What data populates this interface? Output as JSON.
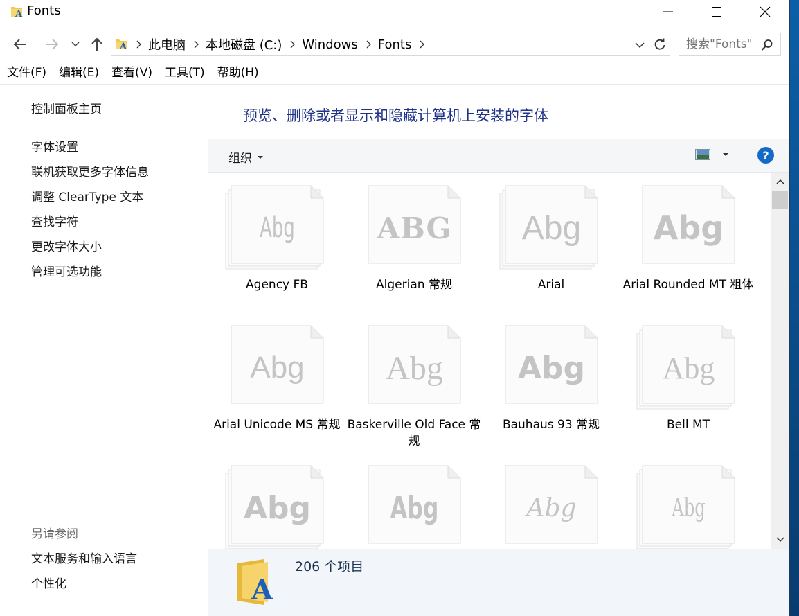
{
  "window": {
    "title": "Fonts"
  },
  "nav": {
    "breadcrumbs": [
      "此电脑",
      "本地磁盘 (C:)",
      "Windows",
      "Fonts"
    ],
    "search_placeholder": "搜索\"Fonts\""
  },
  "menu": [
    "文件(F)",
    "编辑(E)",
    "查看(V)",
    "工具(T)",
    "帮助(H)"
  ],
  "left_pane": {
    "home": "控制面板主页",
    "links": [
      "字体设置",
      "联机获取更多字体信息",
      "调整 ClearType 文本",
      "查找字符",
      "更改字体大小",
      "管理可选功能"
    ],
    "see_also_heading": "另请参阅",
    "see_also": [
      "文本服务和输入语言",
      "个性化"
    ]
  },
  "main": {
    "heading": "预览、删除或者显示和隐藏计算机上安装的字体",
    "organize_label": "组织",
    "help_label": "?"
  },
  "fonts": [
    {
      "label": "Agency FB",
      "preview": "Abg",
      "stacked": true
    },
    {
      "label": "Algerian 常规",
      "preview": "ABG",
      "stacked": false
    },
    {
      "label": "Arial",
      "preview": "Abg",
      "stacked": true
    },
    {
      "label": "Arial Rounded MT 粗体",
      "preview": "Abg",
      "stacked": false
    },
    {
      "label": "Arial Unicode MS 常规",
      "preview": "Abg",
      "stacked": false
    },
    {
      "label": "Baskerville Old Face 常规",
      "preview": "Abg",
      "stacked": false
    },
    {
      "label": "Bauhaus 93 常规",
      "preview": "Abg",
      "stacked": false
    },
    {
      "label": "Bell MT",
      "preview": "Abg",
      "stacked": true
    },
    {
      "label": "",
      "preview": "Abg",
      "stacked": true
    },
    {
      "label": "",
      "preview": "Abg",
      "stacked": false
    },
    {
      "label": "",
      "preview": "Abg",
      "stacked": false
    },
    {
      "label": "",
      "preview": "Abg",
      "stacked": true
    }
  ],
  "details": {
    "count_text": "206 个项目"
  },
  "colors": {
    "heading": "#1e3287",
    "help": "#1569c7",
    "command_bar": "#f4f6f8",
    "details_pane": "#f2f6fb"
  }
}
